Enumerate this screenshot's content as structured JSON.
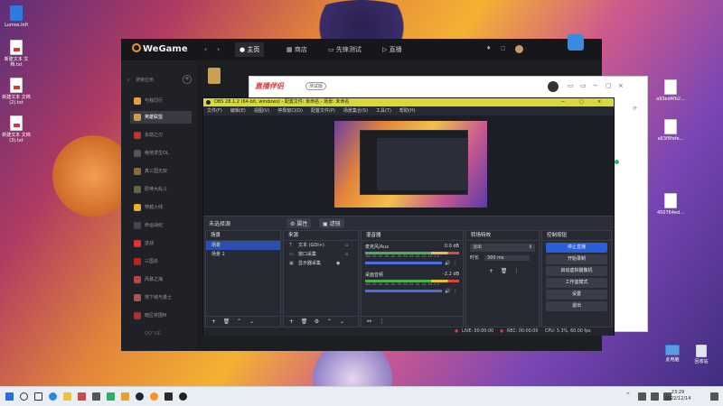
{
  "desktop": {
    "icons_left": [
      "Lumos.Infi",
      "新建文本\n文档.txt",
      "新建文本\n文档(2).txt",
      "新建文本\n文档(3).txt"
    ],
    "icons_right": [
      "a93ed4fb2...",
      "a63f8fefe...",
      "450764ed..."
    ],
    "recycle_labels": [
      "此电脑",
      "回收站"
    ]
  },
  "wegame": {
    "logo": "WeGame",
    "tabs": [
      "主页",
      "商店",
      "先锋测试",
      "直播"
    ],
    "search_placeholder": "搜索应用",
    "games": [
      "与我同行",
      "英雄联盟",
      "永劫之刃",
      "绝地求生OL",
      "真三国无双",
      "原神大乱斗",
      "穿越火线",
      "命运战纪",
      "逆战",
      "三国杀",
      "风暴之海",
      "地下城与勇士",
      "暗区突围M",
      "天天酷跑",
      "QQ飞车"
    ],
    "selected_game": "英雄联盟"
  },
  "live": {
    "brand": "直播伴侣",
    "version": "测试版"
  },
  "obs": {
    "title": "OBS 28.1.2 (64-bit, windows) - 配置文件: 未命名 - 场景: 未命名",
    "menu": [
      "文件(F)",
      "编辑(E)",
      "视图(V)",
      "停靠窗口(D)",
      "配置文件(P)",
      "场景集合(S)",
      "工具(T)",
      "帮助(H)"
    ],
    "no_source": "未选择源",
    "props_btn": "属性",
    "filter_btn": "滤镜",
    "docks": {
      "scenes": {
        "title": "场景",
        "items": [
          "场景",
          "场景 2"
        ]
      },
      "sources": {
        "title": "来源",
        "items": [
          "文本 (GDI+)",
          "窗口采集",
          "显示器采集"
        ]
      },
      "mixer": {
        "title": "混音器",
        "tracks": [
          {
            "name": "麦克风/Aux",
            "db": "0.0 dB"
          },
          {
            "name": "桌面音频",
            "db": "-2.2 dB"
          }
        ],
        "scale": "-60 -55 -50 -45 -40 -35 -30 -25 -20 -15 -10 -5 0"
      },
      "transitions": {
        "title": "转场特效",
        "type": "淡出",
        "duration_label": "时长",
        "duration": "300 ms"
      },
      "controls": {
        "title": "控制按钮",
        "buttons": [
          "停止直播",
          "开始录制",
          "启动虚拟摄像机",
          "工作室模式",
          "设置",
          "退出"
        ]
      }
    },
    "status": {
      "live": "LIVE: 00:00:00",
      "rec": "REC: 00:00:00",
      "cpu": "CPU: 5.3%, 60.00 fps"
    }
  },
  "taskbar": {
    "time": "23:29",
    "date": "2022/12/14"
  }
}
